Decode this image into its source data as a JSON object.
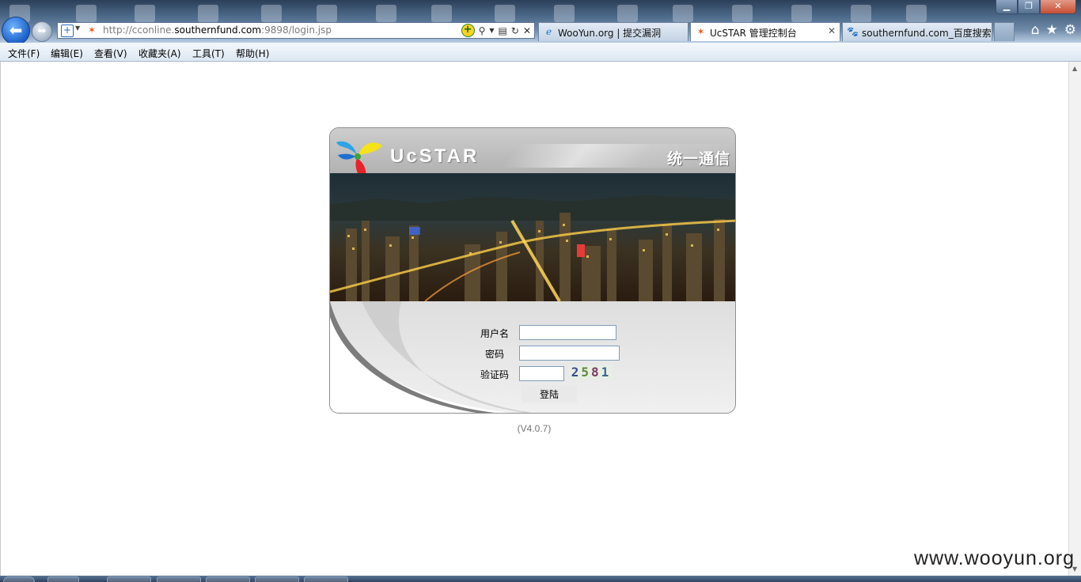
{
  "window": {
    "minimize_label": "▁",
    "maximize_label": "❐",
    "close_label": "✕"
  },
  "nav": {
    "back_icon": "arrow-left-icon",
    "forward_icon": "arrow-right-icon"
  },
  "address": {
    "url_prefix": "http://cconline.",
    "url_host": "southernfund.com",
    "url_suffix": ":9898/login.jsp"
  },
  "tabs": [
    {
      "label": "WooYun.org | 提交漏洞",
      "icon": "ie-page-icon",
      "active": false
    },
    {
      "label": "UcSTAR 管理控制台",
      "icon": "ucstar-favicon",
      "active": true
    },
    {
      "label": "southernfund.com_百度搜索",
      "icon": "baidu-paw-icon",
      "active": false
    }
  ],
  "menu": [
    "文件(F)",
    "编辑(E)",
    "查看(V)",
    "收藏夹(A)",
    "工具(T)",
    "帮助(H)"
  ],
  "login": {
    "brand": "UcSTAR",
    "slogan": "统一通信",
    "username_label": "用户名",
    "password_label": "密码",
    "captcha_label": "验证码",
    "username_value": "",
    "password_value": "",
    "captcha_value": "",
    "captcha_digits": [
      "2",
      "5",
      "8",
      "1"
    ],
    "submit_label": "登陆"
  },
  "version": "(V4.0.7)",
  "watermark": "www.wooyun.org"
}
